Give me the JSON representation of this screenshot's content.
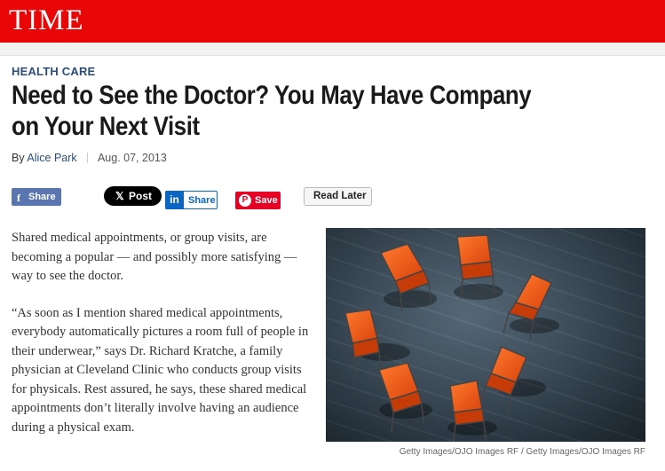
{
  "header": {
    "logo": "TIME"
  },
  "article": {
    "section": "HEALTH CARE",
    "headline": "Need to See the Doctor? You May Have Company on Your Next Visit",
    "byline_prefix": "By",
    "author": "Alice Park",
    "date": "Aug. 07, 2013",
    "paragraphs": [
      "Shared medical appointments, or group visits, are becoming a popular — and possibly more satisfying — way to see the doctor.",
      "“As soon as I mention shared medical appointments, everybody automatically pictures a room full of people in their underwear,” says Dr. Richard Kratche, a family physician at Cleveland Clinic who conducts group visits for physicals. Rest assured, he says, these shared medical appointments don’t literally involve having an audience during a physical exam."
    ],
    "image_caption": "Getty Images/OJO Images RF / Getty Images/OJO Images RF"
  },
  "share": {
    "facebook": {
      "label": "Share",
      "icon": "facebook-icon",
      "color": "#5a76b1"
    },
    "x": {
      "label": "Post",
      "icon": "x-icon",
      "color": "#000000"
    },
    "linkedin": {
      "label": "Share",
      "icon": "linkedin-icon",
      "color": "#0a66c2"
    },
    "pinterest": {
      "label": "Save",
      "icon": "pinterest-icon",
      "color": "#e60023"
    },
    "read_later": {
      "label": "Read Later"
    }
  },
  "colors": {
    "brand_red": "#e90606",
    "section_blue": "#2a4e7c"
  }
}
